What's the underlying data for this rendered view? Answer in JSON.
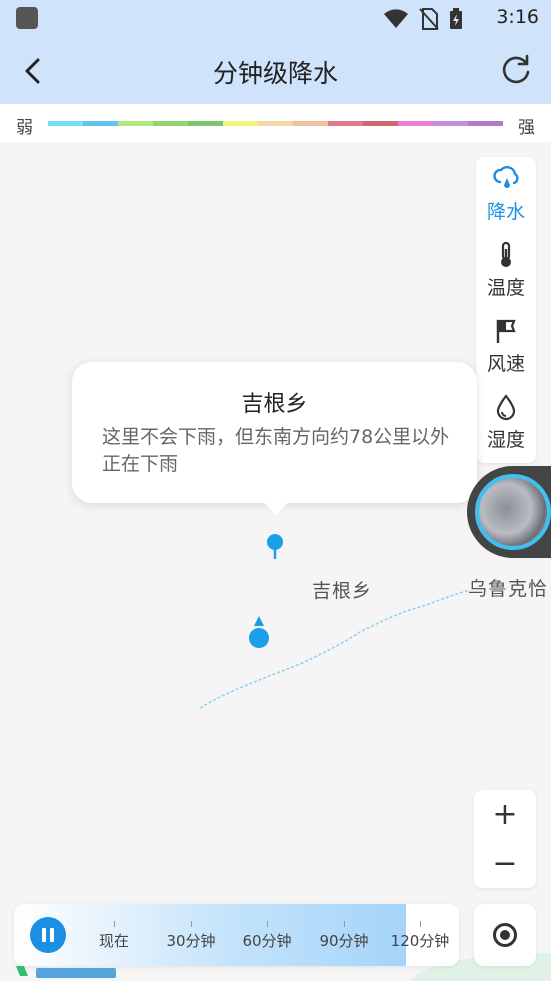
{
  "status_bar": {
    "time": "3:16"
  },
  "header": {
    "title": "分钟级降水"
  },
  "legend": {
    "weak_label": "弱",
    "strong_label": "强",
    "colors": [
      "#6fe3f5",
      "#5fc4ef",
      "#b4e67e",
      "#94d46e",
      "#7cc56c",
      "#f4f578",
      "#f0d9a6",
      "#f0bfa0",
      "#dc7a8e",
      "#c8696f",
      "#e57fd8",
      "#c28fe0",
      "#b07ac8"
    ]
  },
  "layers": [
    {
      "name": "precip",
      "label": "降水",
      "icon": "cloud-rain-icon",
      "active": true
    },
    {
      "name": "temperature",
      "label": "温度",
      "icon": "thermometer-icon",
      "active": false
    },
    {
      "name": "wind",
      "label": "风速",
      "icon": "wind-flag-icon",
      "active": false
    },
    {
      "name": "humidity",
      "label": "湿度",
      "icon": "water-drop-icon",
      "active": false
    }
  ],
  "popup": {
    "title": "吉根乡",
    "description": "这里不会下雨，但东南方向约78公里以外正在下雨"
  },
  "map_labels": {
    "town": "吉根乡",
    "neighbor": "乌鲁克恰"
  },
  "zoom": {
    "in": "+",
    "out": "−"
  },
  "timeline": {
    "progress": 0.88,
    "labels": [
      "现在",
      "30分钟",
      "60分钟",
      "90分钟",
      "120分钟"
    ],
    "state": "playing"
  },
  "colors": {
    "accent": "#1a8fe3",
    "header_bg": "#cfe3fb"
  }
}
